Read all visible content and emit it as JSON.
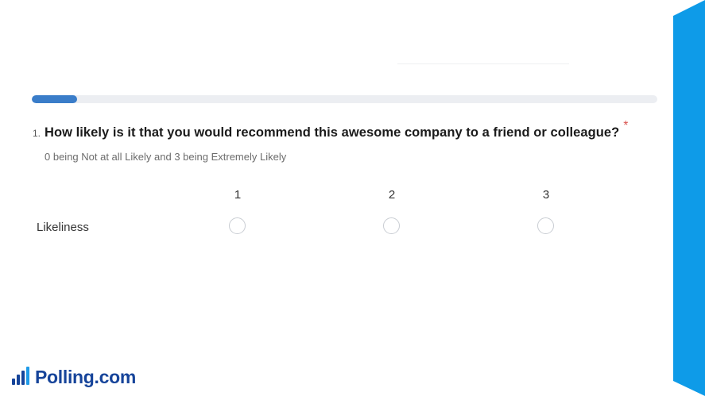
{
  "progress": {
    "fraction": 0.072,
    "fill_color": "#3a7dc9",
    "track_color": "#eceef2"
  },
  "question": {
    "number": "1.",
    "text": "How likely is it that you would recommend this awesome company to a friend or colleague?",
    "required_marker": "*",
    "hint": "0 being Not at all Likely and 3 being Extremely Likely"
  },
  "matrix": {
    "columns": [
      "1",
      "2",
      "3"
    ],
    "rows": [
      {
        "label": "Likeliness"
      }
    ]
  },
  "logo": {
    "text": "Polling.com",
    "icon": "bar-chart-icon",
    "color": "#16449a"
  },
  "side_band": {
    "color": "#0e9be8"
  }
}
